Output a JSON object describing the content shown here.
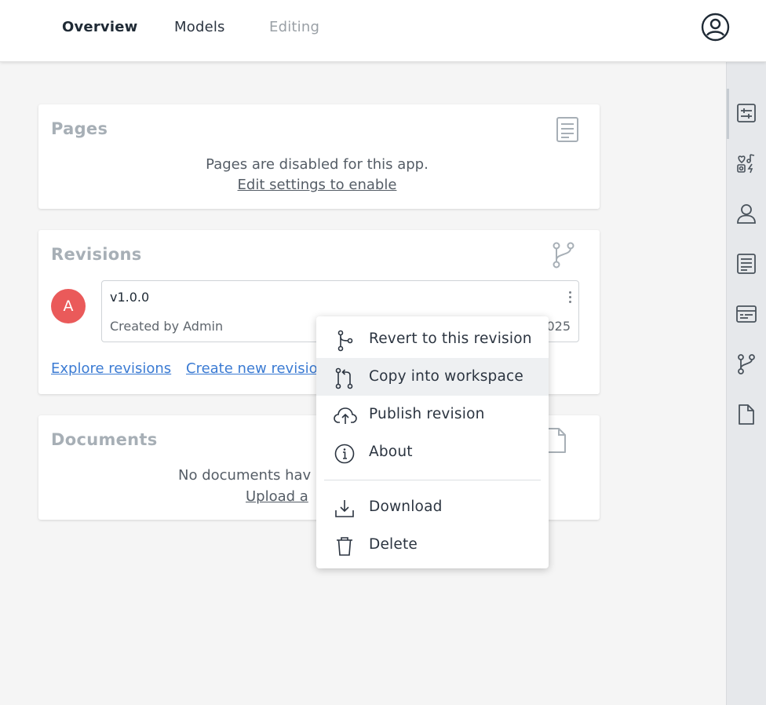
{
  "nav": {
    "tabs": [
      {
        "label": "Overview",
        "state": "active"
      },
      {
        "label": "Models",
        "state": "normal"
      },
      {
        "label": "Editing",
        "state": "disabled"
      }
    ],
    "account_icon": "user-circle-icon"
  },
  "pages_card": {
    "title": "Pages",
    "icon": "document-lines-icon",
    "message": "Pages are disabled for this app.",
    "link": "Edit settings to enable"
  },
  "revisions_card": {
    "title": "Revisions",
    "icon": "branch-icon",
    "revision": {
      "avatar_letter": "A",
      "version": "v1.0.0",
      "created_by": "Created by Admin",
      "date_tail": "025"
    },
    "links": [
      "Explore revisions",
      "Create new revisio"
    ]
  },
  "documents_card": {
    "title": "Documents",
    "icon": "file-icon",
    "message": "No documents hav",
    "link": "Upload a "
  },
  "context_menu": {
    "items": [
      {
        "label": "Revert to this revision",
        "icon": "branch-icon"
      },
      {
        "label": "Copy into workspace",
        "icon": "pull-request-icon",
        "hovered": true
      },
      {
        "label": "Publish revision",
        "icon": "cloud-upload-icon"
      },
      {
        "label": "About",
        "icon": "info-icon"
      },
      {
        "label": "Download",
        "icon": "download-icon"
      },
      {
        "label": "Delete",
        "icon": "trash-icon"
      }
    ]
  },
  "sidebar": {
    "icons": [
      "sliders-icon",
      "shapes-icon",
      "user-icon",
      "document-lines-icon",
      "card-icon",
      "branch-icon",
      "file-icon"
    ]
  },
  "colors": {
    "avatar": "#ea5a5a",
    "link_blue": "#3b7bd3",
    "card_title": "#a7afb6"
  }
}
